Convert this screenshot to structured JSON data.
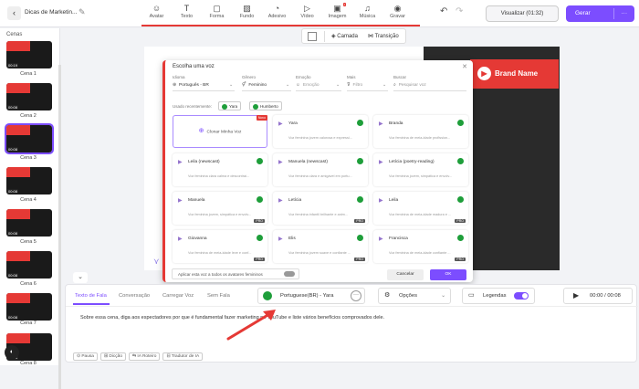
{
  "header": {
    "title": "Dicas de Marketin...",
    "visualizar": "Visualizar (01:32)",
    "gerar": "Gerar"
  },
  "tools": [
    "Avatar",
    "Texto",
    "Forma",
    "Fundo",
    "Adesivo",
    "Vídeo",
    "Imagem",
    "Música",
    "Gravar"
  ],
  "sidebar": {
    "title": "Cenas",
    "scenes": [
      {
        "label": "Cena 1",
        "dur": "00:19"
      },
      {
        "label": "Cena 2",
        "dur": "00:08"
      },
      {
        "label": "Cena 3",
        "dur": "00:08"
      },
      {
        "label": "Cena 4",
        "dur": "00:08"
      },
      {
        "label": "Cena 5",
        "dur": "00:08"
      },
      {
        "label": "Cena 6",
        "dur": "00:08"
      },
      {
        "label": "Cena 7",
        "dur": "00:08"
      },
      {
        "label": "Cena 8",
        "dur": "00:08"
      }
    ]
  },
  "canvas": {
    "camada": "Camada",
    "transicao": "Transição",
    "brand": "Brand Name"
  },
  "dialog": {
    "title": "Escolha uma voz",
    "filters": [
      {
        "label": "Idioma",
        "value": "Português - BR"
      },
      {
        "label": "Gênero",
        "value": "Feminino"
      },
      {
        "label": "Emoção",
        "value": "Emoção"
      },
      {
        "label": "Mais",
        "value": "Filtro"
      },
      {
        "label": "Buscar",
        "value": "Pesquisar voz"
      }
    ],
    "used_label": "Usado recentemente:",
    "used": [
      "Yara",
      "Humberto"
    ],
    "clone": "Clonar Minha Voz",
    "novo": "Novo",
    "cards": [
      {
        "name": "Yara",
        "desc": "Voz feminina jovem calorosa e expressi..."
      },
      {
        "name": "Branda",
        "desc": "Voz feminina de meia-idade profission..."
      },
      {
        "name": "Leila (newscast)",
        "desc": "Voz feminina clara calma e descontraí..."
      },
      {
        "name": "Manuela (newscast)",
        "desc": "Voz feminina clara e amigável em portu..."
      },
      {
        "name": "Letícia (poetry-reading)",
        "desc": "Voz feminina jovem, simpática e envolv..."
      },
      {
        "name": "Manuela",
        "desc": "Voz feminina jovem, simpática e envolv...",
        "pro": "PRO"
      },
      {
        "name": "Letícia",
        "desc": "Voz feminina infantil brilhante e anim...",
        "pro": "PRO"
      },
      {
        "name": "Leila",
        "desc": "Voz feminina de meia-idade madura e ...",
        "pro": "PRO"
      },
      {
        "name": "Giovanna",
        "desc": "Voz feminina de meia-idade leve e conf...",
        "pro": "PRO"
      },
      {
        "name": "Elis",
        "desc": "Voz feminina jovem suave e confiante ...",
        "pro": "PRO"
      },
      {
        "name": "Francisca",
        "desc": "Voz feminina de meia-idade confiante ...",
        "pro": "PRO"
      }
    ],
    "apply": "Aplicar esta voz a todos os avatares femininos",
    "cancel": "Cancelar",
    "ok": "OK"
  },
  "bottom": {
    "tabs": [
      "Texto de Fala",
      "Conversação",
      "Carregar Voz",
      "Sem Fala"
    ],
    "voice": "Portuguese(BR) - Yara",
    "options": "Opções",
    "legendas": "Legendas",
    "time": "00:00 / 00:08",
    "text": "Sobre essa cena, diga aos espectadores por que é fundamental fazer marketing no YouTube e liste vários benefícios comprovados dele.",
    "tools": [
      "Pausa",
      "Dicção",
      "IA Roteiro",
      "Tradutor de IA"
    ]
  }
}
